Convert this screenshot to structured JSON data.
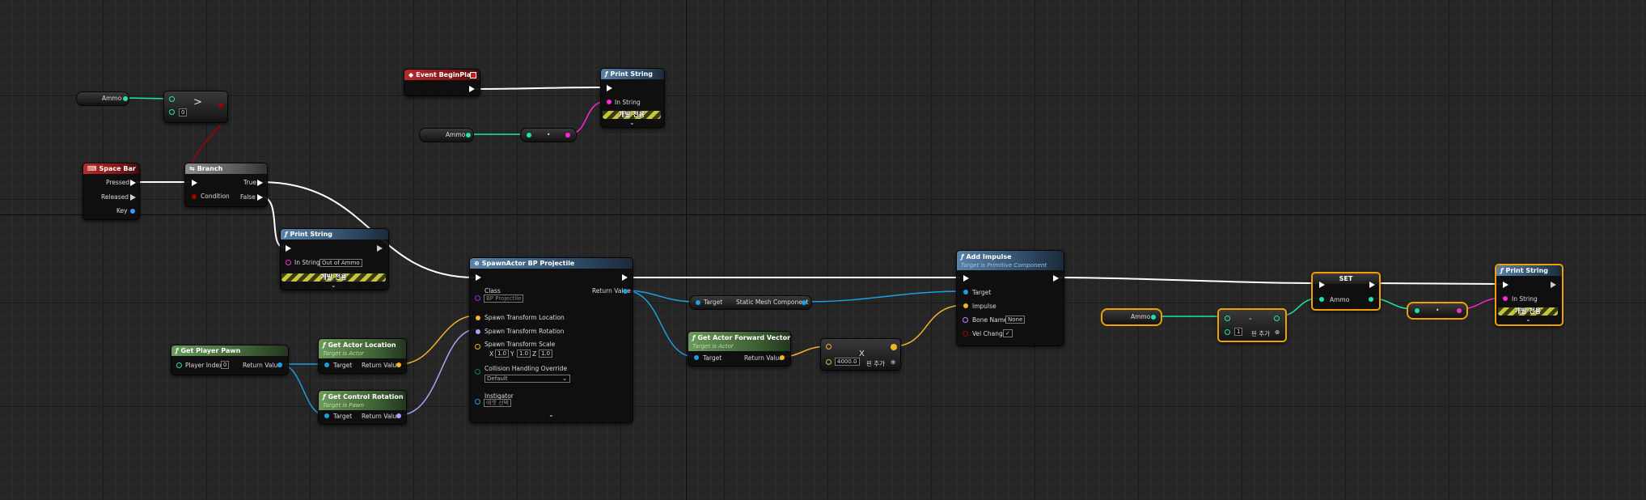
{
  "colors": {
    "exec": "#ffffff",
    "integer": "#1fe3af",
    "boolean": "#a00000",
    "object": "#1d9fe0",
    "vector": "#f2b52a",
    "rotator": "#a5a5f6",
    "string": "#fb29d7",
    "struct": "#3e9aff",
    "name": "#c981fa",
    "selection": "#f0a000"
  },
  "nodes": {
    "begin_play": {
      "title": "Event BeginPlay"
    },
    "print1": {
      "title": "Print String",
      "in_string": "In String",
      "dev": "개발 전용"
    },
    "ammo_get1": {
      "label": "Ammo"
    },
    "ammo_get2": {
      "label": "Ammo"
    },
    "ammo_get3": {
      "label": "Ammo"
    },
    "greater": {
      "symbol": ">",
      "b_value": "0"
    },
    "conv1": {
      "symbol": "•"
    },
    "conv2": {
      "symbol": "•"
    },
    "space_bar": {
      "title": "Space Bar",
      "pressed": "Pressed",
      "released": "Released",
      "key": "Key"
    },
    "branch": {
      "title": "Branch",
      "condition": "Condition",
      "true": "True",
      "false": "False"
    },
    "print2": {
      "title": "Print String",
      "in_string": "In String",
      "value": "Out of Ammo",
      "dev": "개발 전용"
    },
    "spawn": {
      "title": "SpawnActor BP Projectile",
      "class": "Class",
      "class_value": "BP Projectile",
      "return": "Return Value",
      "loc": "Spawn Transform Location",
      "rot": "Spawn Transform Rotation",
      "scale": "Spawn Transform Scale",
      "sx": "1.0",
      "sy": "1.0",
      "sz": "1.0",
      "x": "X",
      "y": "Y",
      "z": "Z",
      "coll": "Collision Handling Override",
      "coll_value": "Default",
      "instig": "Instigator",
      "instig_value": "애셋 선택"
    },
    "get_pawn": {
      "title": "Get Player Pawn",
      "player_index": "Player Index",
      "index_value": "0",
      "return": "Return Value"
    },
    "get_loc": {
      "title": "Get Actor Location",
      "sub": "Target is Actor",
      "target": "Target",
      "return": "Return Value"
    },
    "get_rot": {
      "title": "Get Control Rotation",
      "sub": "Target is Pawn",
      "target": "Target",
      "return": "Return Value"
    },
    "static_mesh": {
      "target": "Target",
      "label": "Static Mesh Component"
    },
    "forward": {
      "title": "Get Actor Forward Vector",
      "sub": "Target is Actor",
      "target": "Target",
      "return": "Return Value"
    },
    "multiply": {
      "symbol": "X",
      "value": "4000.0",
      "add_pin": "핀 추가"
    },
    "impulse": {
      "title": "Add Impulse",
      "sub": "Target is Primitive Component",
      "target": "Target",
      "impulse": "Impulse",
      "bone": "Bone Name",
      "bone_value": "None",
      "vel": "Vel Change"
    },
    "subtract": {
      "symbol": "-",
      "value": "1",
      "add_pin": "핀 추가"
    },
    "set": {
      "title": "SET",
      "label": "Ammo"
    },
    "print3": {
      "title": "Print String",
      "in_string": "In String",
      "dev": "개발 전용"
    }
  }
}
